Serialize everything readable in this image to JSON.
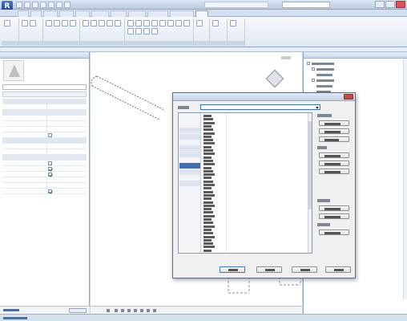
{
  "app": {
    "logo": "R"
  },
  "dialog": {
    "close_icon": "×"
  },
  "icons": {
    "app_logo": "revit-logo-icon",
    "viewcube": "viewcube-icon",
    "close": "close-icon",
    "dropdown": "chevron-down-icon",
    "checkbox": "checkbox-icon"
  },
  "colors": {
    "accent": "#3b73c9",
    "selection": "#3d6fb6",
    "ribbon_highlight": "#fbe3a8"
  }
}
